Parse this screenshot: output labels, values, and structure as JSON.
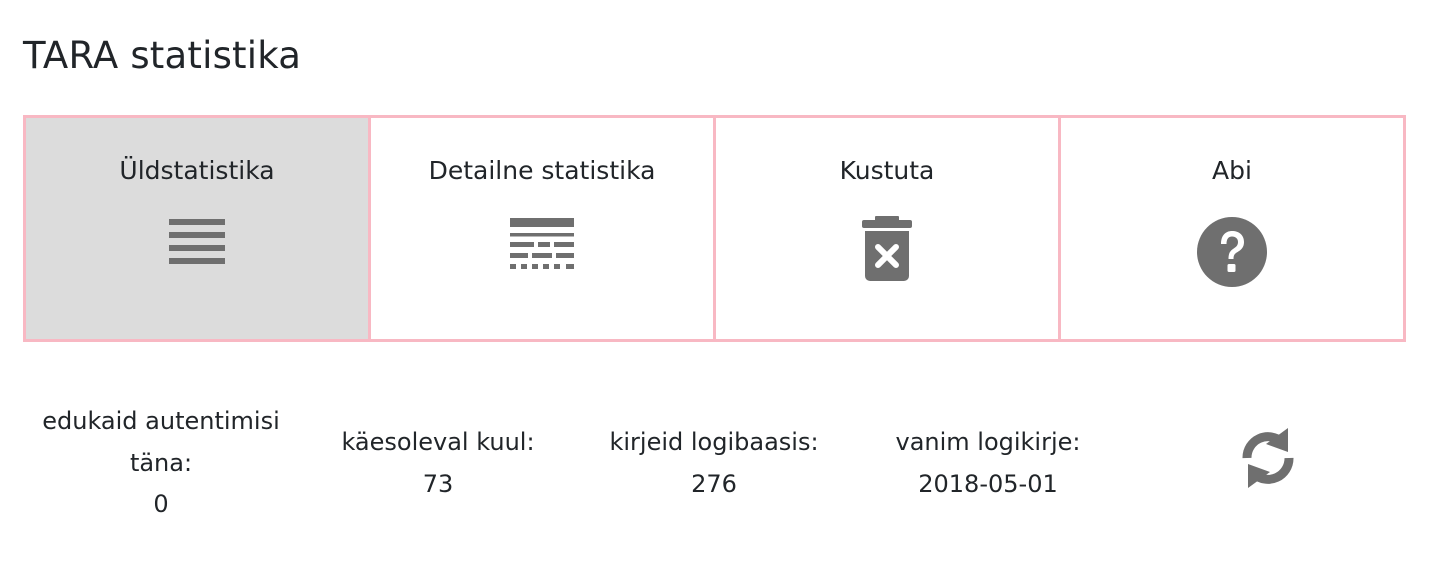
{
  "page": {
    "title": "TARA statistika"
  },
  "tabs": [
    {
      "label": "Üldstatistika",
      "icon": "list-icon",
      "active": true
    },
    {
      "label": "Detailne statistika",
      "icon": "detailed-list-icon",
      "active": false
    },
    {
      "label": "Kustuta",
      "icon": "trash-icon",
      "active": false
    },
    {
      "label": "Abi",
      "icon": "question-circle-icon",
      "active": false
    }
  ],
  "stats": {
    "successful_today": {
      "label": "edukaid autentimisi täna:",
      "value": "0"
    },
    "this_month": {
      "label": "käesoleval kuul:",
      "value": "73"
    },
    "log_records": {
      "label": "kirjeid logibaasis:",
      "value": "276"
    },
    "oldest_log": {
      "label": "vanim logikirje:",
      "value": "2018-05-01"
    },
    "refresh_icon": "refresh-icon"
  },
  "colors": {
    "tab_border": "#f8b8c3",
    "active_tab_bg": "#dcdcdc",
    "icon": "#6f6f6f",
    "text": "#212529"
  }
}
